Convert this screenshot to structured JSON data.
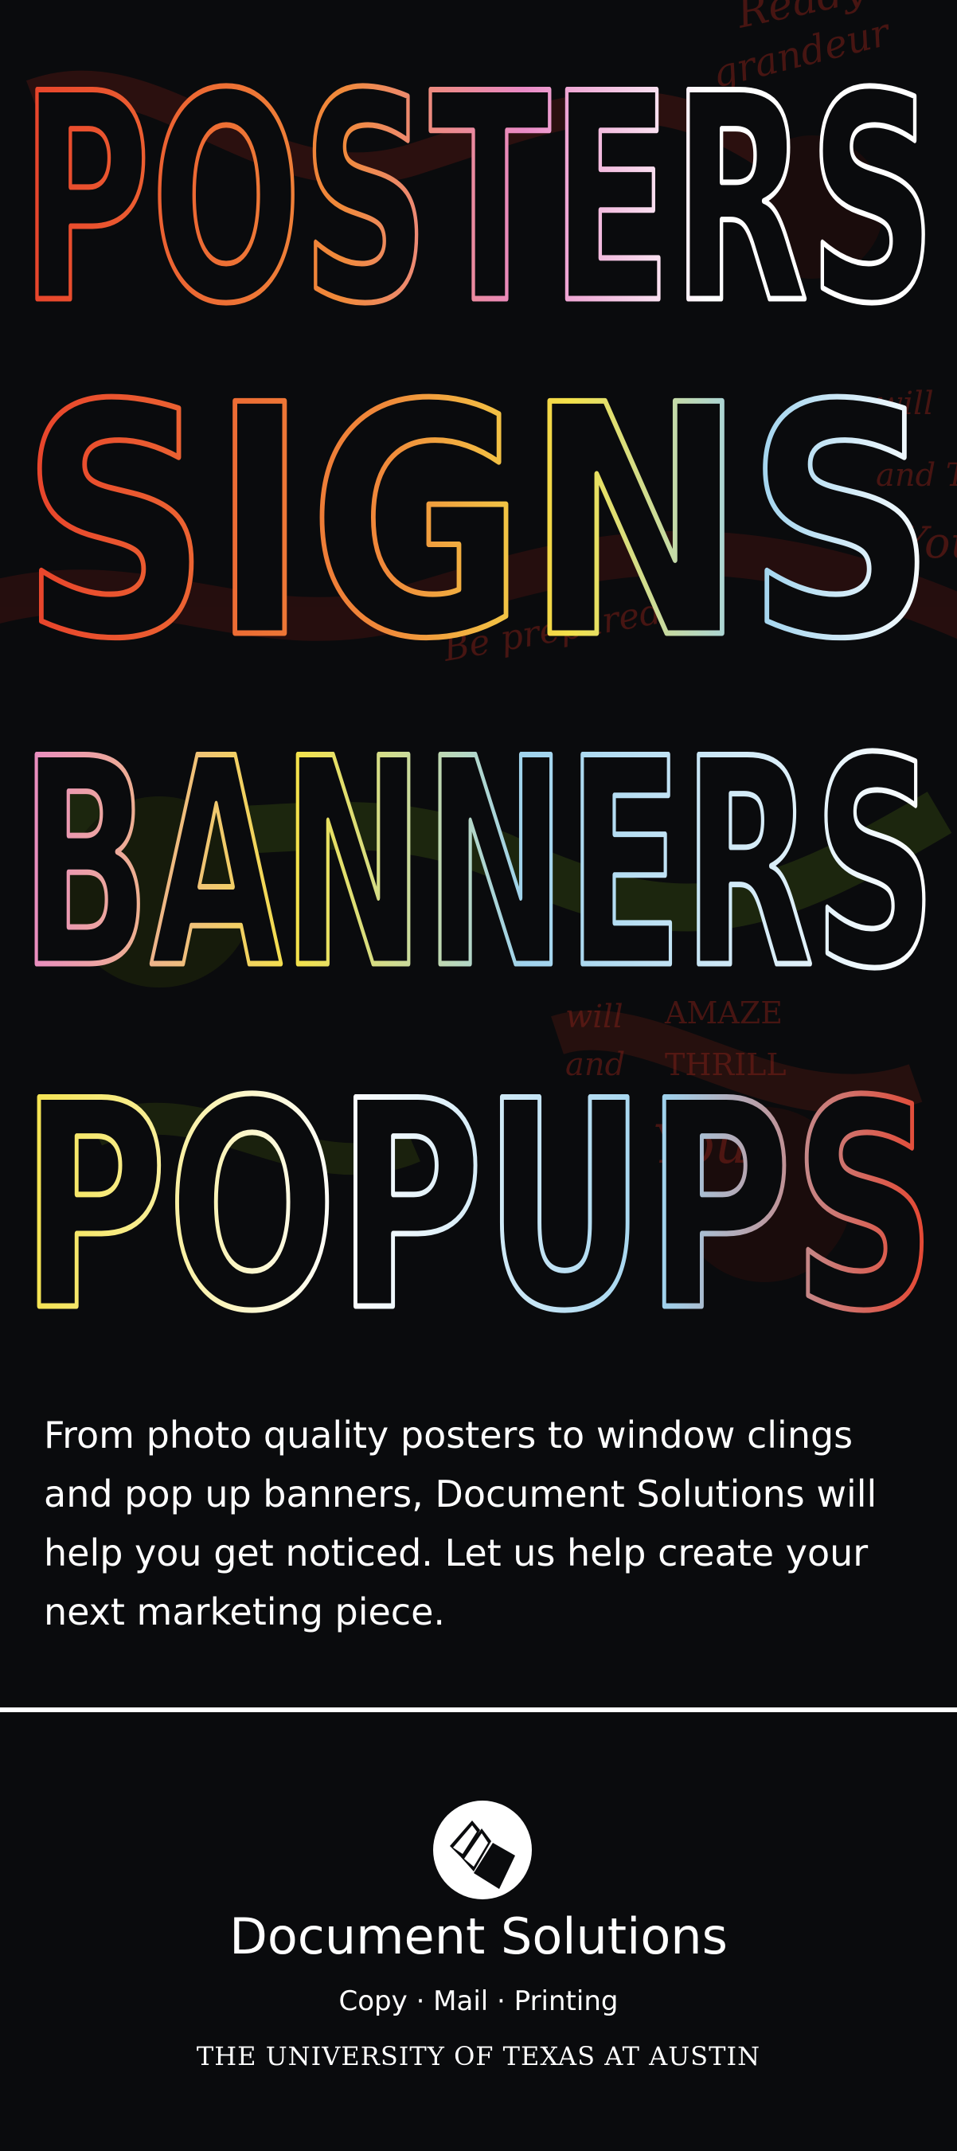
{
  "headline": {
    "words": [
      "POSTERS",
      "SIGNS",
      "BANNERS",
      "POPUPS"
    ]
  },
  "background_script": [
    "Ready",
    "grandeur",
    "will",
    "and T",
    "You",
    "Be prepared",
    "will",
    "AMAZE",
    "and",
    "THRILL",
    "You!"
  ],
  "body_text": "From photo quality posters to window clings and pop up banners, Document Solutions will help you get noticed. Let us help create your next marketing piece.",
  "brand": {
    "logo_icon": "document-solutions-logo-icon",
    "name": "Document Solutions",
    "tagline": "Copy · Mail · Printing",
    "university": "THE UNIVERSITY OF TEXAS AT AUSTIN"
  },
  "colors": {
    "background": "#0a0b0d",
    "text": "#ffffff",
    "outline_red": "#e8422b",
    "outline_orange": "#f08a3a",
    "outline_yellow": "#f4e24a",
    "outline_pink": "#e98ac6",
    "outline_blue": "#9fd3ee",
    "outline_white": "#ffffff"
  }
}
